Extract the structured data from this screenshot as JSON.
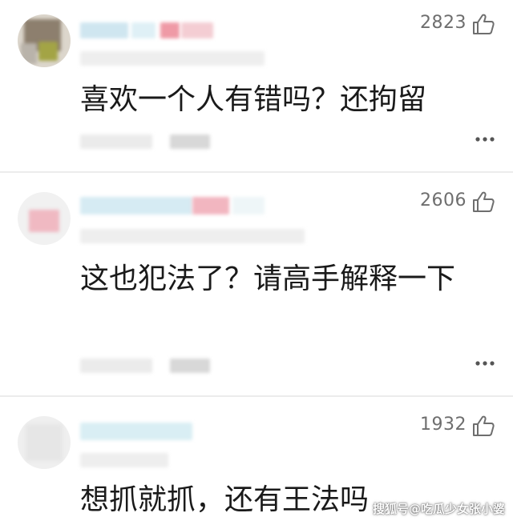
{
  "comments": [
    {
      "likes": "2823",
      "text": "喜欢一个人有错吗？还拘留"
    },
    {
      "likes": "2606",
      "text": "这也犯法了？请高手解释一下"
    },
    {
      "likes": "1932",
      "text": "想抓就抓，还有王法吗"
    }
  ],
  "icons": {
    "like": "thumbs-up-icon",
    "more": "more-dots-icon"
  },
  "watermark": "搜狐号@吃瓜少女张小婆",
  "colors": {
    "text": "#1a1a1a",
    "meta": "#6e6e6e",
    "divider": "#ececec"
  }
}
